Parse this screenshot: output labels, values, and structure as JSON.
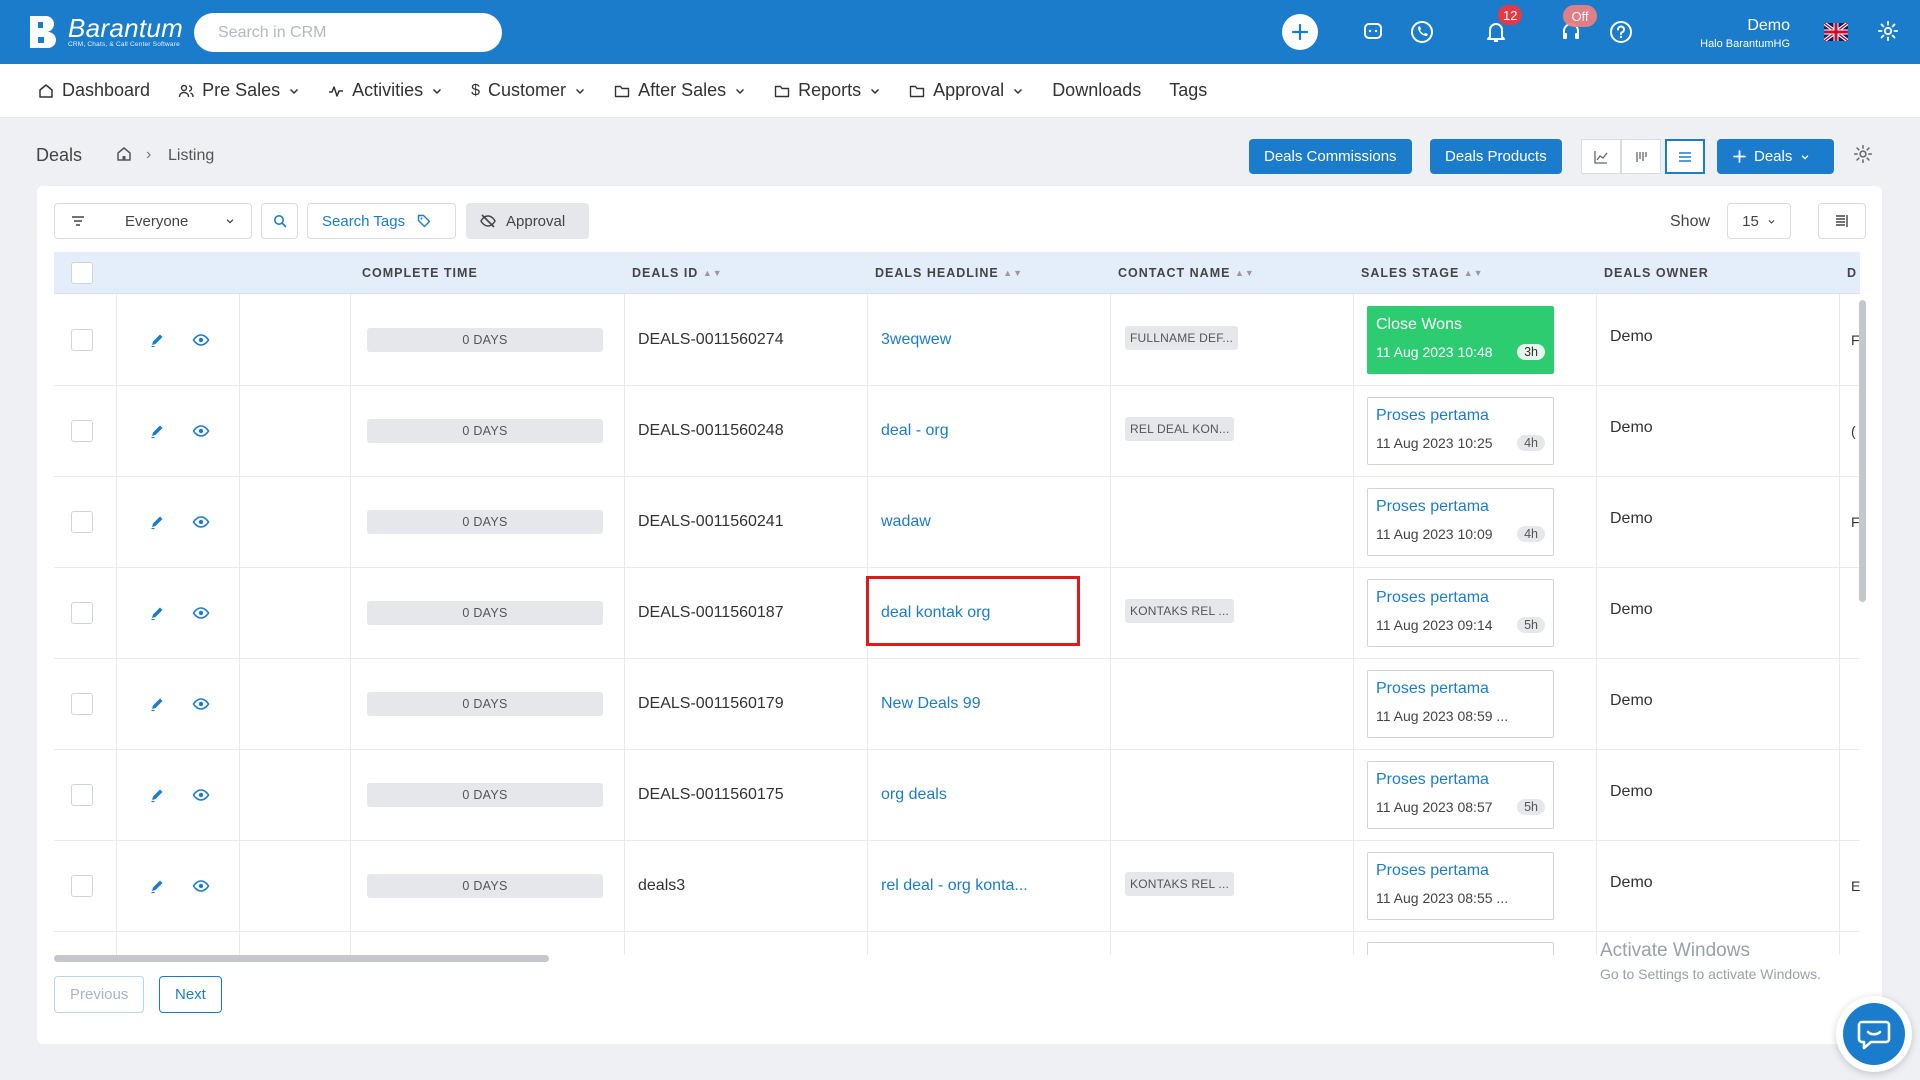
{
  "app": {
    "name": "Barantum",
    "tagline": "CRM, Chats, & Call Center Software",
    "search_placeholder": "Search in CRM",
    "notifications_count": "12",
    "status_badge": "Off",
    "user_name": "Demo",
    "user_org": "Halo BarantumHG"
  },
  "nav": [
    {
      "label": "Dashboard",
      "icon": "home-icon",
      "dropdown": false
    },
    {
      "label": "Pre Sales",
      "icon": "users-icon",
      "dropdown": true
    },
    {
      "label": "Activities",
      "icon": "activity-icon",
      "dropdown": true
    },
    {
      "label": "Customer",
      "icon": "dollar-icon",
      "dropdown": true
    },
    {
      "label": "After Sales",
      "icon": "folder-icon",
      "dropdown": true
    },
    {
      "label": "Reports",
      "icon": "folder-icon",
      "dropdown": true
    },
    {
      "label": "Approval",
      "icon": "folder-icon",
      "dropdown": true
    },
    {
      "label": "Downloads",
      "icon": "",
      "dropdown": false
    },
    {
      "label": "Tags",
      "icon": "",
      "dropdown": false
    }
  ],
  "page": {
    "title": "Deals",
    "breadcrumb_current": "Listing",
    "btn_commissions": "Deals Commissions",
    "btn_products": "Deals Products",
    "btn_add": "Deals"
  },
  "filters": {
    "owner_filter": "Everyone",
    "search_tags": "Search Tags",
    "approval": "Approval",
    "show_label": "Show",
    "show_value": "15"
  },
  "table": {
    "columns": [
      "COMPLETE TIME",
      "DEALS ID",
      "DEALS HEADLINE",
      "CONTACT NAME",
      "SALES STAGE",
      "DEALS OWNER",
      "D"
    ],
    "rows": [
      {
        "days": "0 DAYS",
        "id": "DEALS-0011560274",
        "headline": "3weqwew",
        "contact": "FULLNAME DEF...",
        "stage": "Close Wons",
        "stage_date": "11 Aug 2023 10:48",
        "stage_hrs": "3h",
        "won": true,
        "owner": "Demo",
        "last": "F"
      },
      {
        "days": "0 DAYS",
        "id": "DEALS-0011560248",
        "headline": "deal - org",
        "contact": "REL DEAL KON...",
        "stage": "Proses pertama",
        "stage_date": "11 Aug 2023 10:25",
        "stage_hrs": "4h",
        "won": false,
        "owner": "Demo",
        "last": "("
      },
      {
        "days": "0 DAYS",
        "id": "DEALS-0011560241",
        "headline": "wadaw",
        "contact": "",
        "stage": "Proses pertama",
        "stage_date": "11 Aug 2023 10:09",
        "stage_hrs": "4h",
        "won": false,
        "owner": "Demo",
        "last": "F"
      },
      {
        "days": "0 DAYS",
        "id": "DEALS-0011560187",
        "headline": "deal kontak org",
        "contact": "KONTAKS REL ...",
        "stage": "Proses pertama",
        "stage_date": "11 Aug 2023 09:14",
        "stage_hrs": "5h",
        "won": false,
        "owner": "Demo",
        "last": ""
      },
      {
        "days": "0 DAYS",
        "id": "DEALS-0011560179",
        "headline": "New Deals 99",
        "contact": "",
        "stage": "Proses pertama",
        "stage_date": "11 Aug 2023 08:59 ...",
        "stage_hrs": "",
        "won": false,
        "owner": "Demo",
        "last": ""
      },
      {
        "days": "0 DAYS",
        "id": "DEALS-0011560175",
        "headline": "org deals",
        "contact": "",
        "stage": "Proses pertama",
        "stage_date": "11 Aug 2023 08:57",
        "stage_hrs": "5h",
        "won": false,
        "owner": "Demo",
        "last": ""
      },
      {
        "days": "0 DAYS",
        "id": "deals3",
        "headline": "rel deal - org konta...",
        "contact": "KONTAKS REL ...",
        "stage": "Proses pertama",
        "stage_date": "11 Aug 2023 08:55 ...",
        "stage_hrs": "",
        "won": false,
        "owner": "Demo",
        "last": "E"
      }
    ]
  },
  "pagination": {
    "previous": "Previous",
    "next": "Next"
  },
  "watermark": {
    "line1": "Activate Windows",
    "line2": "Go to Settings to activate Windows."
  },
  "colors": {
    "primary": "#1b7ccc",
    "won": "#2ecc71",
    "highlight": "#e0191e"
  }
}
